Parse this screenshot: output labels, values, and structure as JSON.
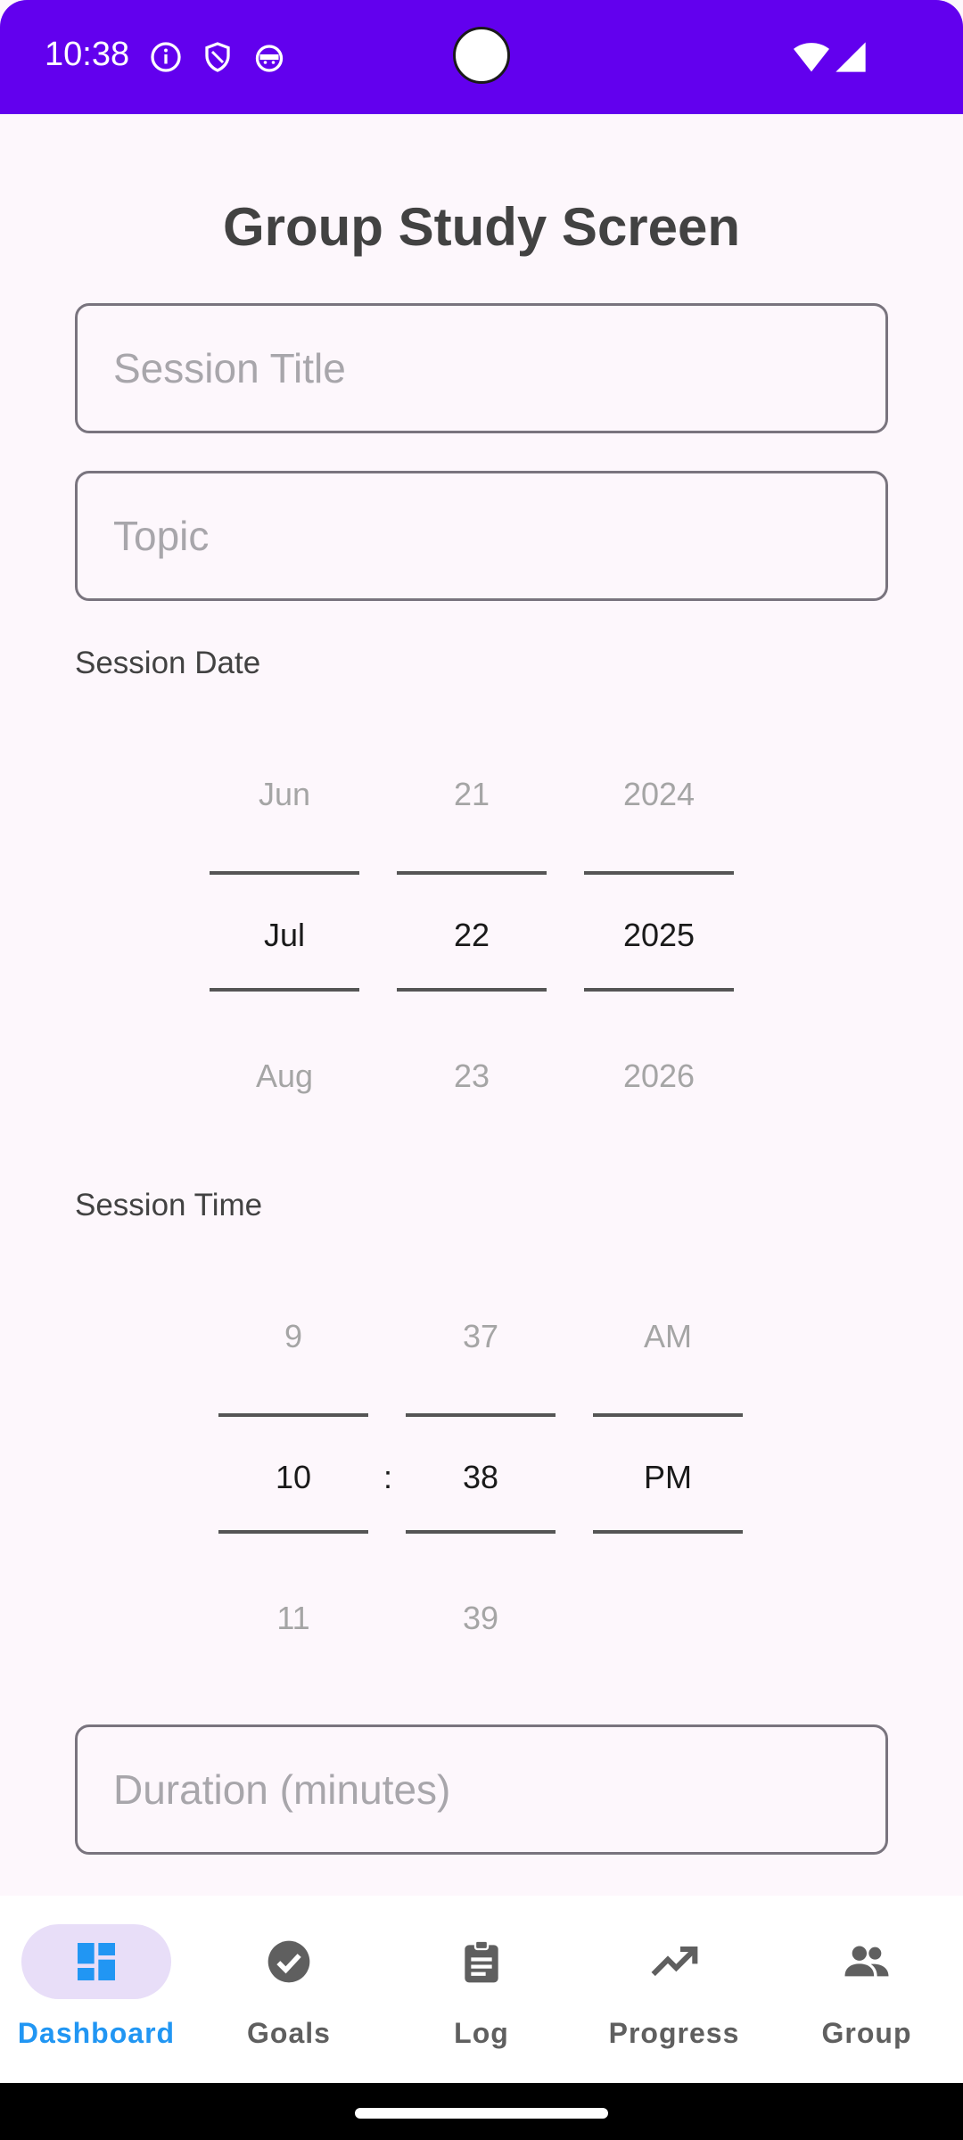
{
  "status_bar": {
    "time": "10:38",
    "icons": [
      "info-icon",
      "shield-icon",
      "android-icon",
      "wifi-icon",
      "signal-icon"
    ],
    "background": "#6200ee"
  },
  "page": {
    "title": "Group Study Screen"
  },
  "form": {
    "session_title": {
      "placeholder": "Session Title",
      "value": ""
    },
    "topic": {
      "placeholder": "Topic",
      "value": ""
    },
    "date_label": "Session Date",
    "date_picker": {
      "month": {
        "prev": "Jun",
        "selected": "Jul",
        "next": "Aug"
      },
      "day": {
        "prev": "21",
        "selected": "22",
        "next": "23"
      },
      "year": {
        "prev": "2024",
        "selected": "2025",
        "next": "2026"
      }
    },
    "time_label": "Session Time",
    "time_picker": {
      "hour": {
        "prev": "9",
        "selected": "10",
        "next": "11"
      },
      "separator": ":",
      "minute": {
        "prev": "37",
        "selected": "38",
        "next": "39"
      },
      "ampm": {
        "prev": "AM",
        "selected": "PM",
        "next": ""
      }
    },
    "duration": {
      "placeholder": "Duration (minutes)",
      "value": ""
    }
  },
  "bottom_nav": {
    "active_color": "#2196f3",
    "items": [
      {
        "label": "Dashboard",
        "icon": "dashboard-icon",
        "active": true
      },
      {
        "label": "Goals",
        "icon": "check-circle-icon",
        "active": false
      },
      {
        "label": "Log",
        "icon": "clipboard-icon",
        "active": false
      },
      {
        "label": "Progress",
        "icon": "trending-up-icon",
        "active": false
      },
      {
        "label": "Group",
        "icon": "people-icon",
        "active": false
      }
    ]
  }
}
